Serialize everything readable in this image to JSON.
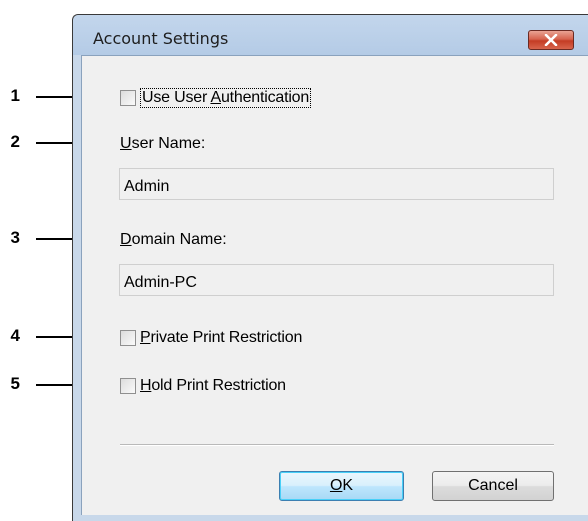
{
  "callouts": [
    "1",
    "2",
    "3",
    "4",
    "5"
  ],
  "dialog": {
    "title": "Account Settings",
    "use_user_auth": {
      "prefix": "Use User ",
      "accel": "A",
      "suffix": "uthentication",
      "checked": false
    },
    "user_name": {
      "accel": "U",
      "label_rest": "ser Name:",
      "value": "Admin"
    },
    "domain_name": {
      "accel": "D",
      "label_rest": "omain Name:",
      "value": "Admin-PC"
    },
    "private_print": {
      "accel": "P",
      "label_rest": "rivate Print Restriction",
      "checked": false
    },
    "hold_print": {
      "accel": "H",
      "label_rest": "old Print Restriction",
      "checked": false
    },
    "buttons": {
      "ok": {
        "accel": "O",
        "rest": "K"
      },
      "cancel": "Cancel"
    }
  },
  "colors": {
    "window_frame": "#c8d8ea",
    "client_bg": "#f0f0f0",
    "close_button": "#c43c24",
    "default_button_border": "#3c7fb1"
  },
  "icons": {
    "close": "close-icon"
  }
}
